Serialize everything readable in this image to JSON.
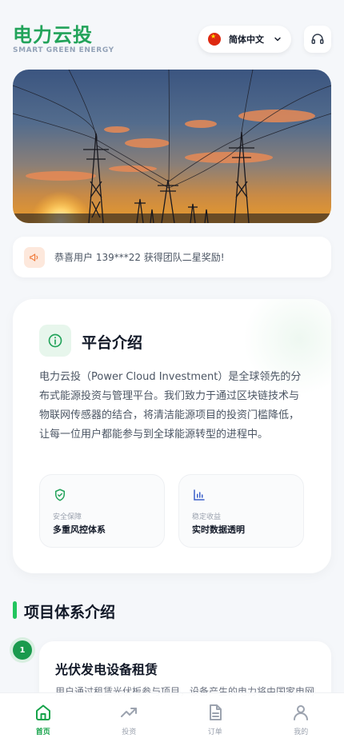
{
  "header": {
    "title": "电力云投",
    "subtitle": "SMART GREEN ENERGY",
    "language": "简体中文",
    "flag_icon": "china-flag-icon",
    "support_icon": "headset-icon"
  },
  "hero": {
    "image_subject": "electricity transmission towers at sunset"
  },
  "notice": {
    "icon": "megaphone-icon",
    "text": "恭喜用户 139***22 获得团队二星奖励!"
  },
  "intro": {
    "icon": "info-icon",
    "title": "平台介绍",
    "body": "电力云投（Power Cloud Investment）是全球领先的分布式能源投资与管理平台。我们致力于通过区块链技术与物联网传感器的结合，将清洁能源项目的投资门槛降低，让每一位用户都能参与到全球能源转型的进程中。",
    "features": [
      {
        "icon": "shield-check-icon",
        "label": "安全保障",
        "value": "多重风控体系"
      },
      {
        "icon": "bar-chart-icon",
        "label": "稳定收益",
        "value": "实时数据透明"
      }
    ]
  },
  "projects": {
    "title": "项目体系介绍",
    "steps": [
      {
        "number": "1",
        "title": "光伏发电设备租赁",
        "desc": "用户通过租赁光伏板参与项目，设备产生的电力将由国家电网"
      }
    ]
  },
  "nav": {
    "items": [
      {
        "label": "首页",
        "icon": "home-icon",
        "active": true
      },
      {
        "label": "投资",
        "icon": "trending-up-icon",
        "active": false
      },
      {
        "label": "订单",
        "icon": "document-icon",
        "active": false
      },
      {
        "label": "我的",
        "icon": "user-icon",
        "active": false
      }
    ]
  },
  "colors": {
    "brand_green": "#22a35a",
    "accent_green": "#22c55e",
    "nav_active": "#16a34a",
    "notice_orange": "#f07a3a",
    "feature_blue": "#3b5fc9"
  }
}
